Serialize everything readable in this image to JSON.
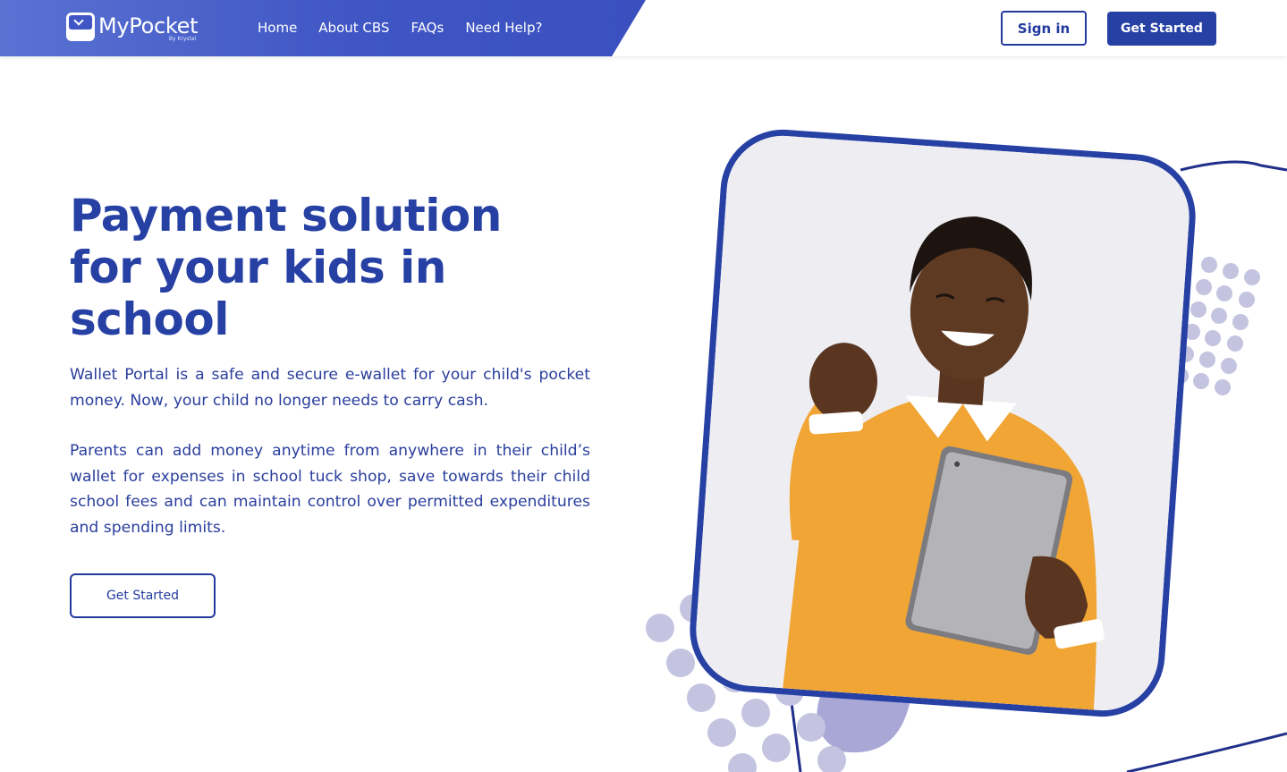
{
  "brand": {
    "name": "MyPocket",
    "byline": "By Krystal",
    "band_color": "#3f56c4"
  },
  "nav": {
    "items": [
      "Home",
      "About CBS",
      "FAQs",
      "Need Help?"
    ]
  },
  "header": {
    "signin_label": "Sign in",
    "get_started_label": "Get Started"
  },
  "hero": {
    "title": "Payment solution for your kids in school",
    "paragraph1": "Wallet Portal is a safe and secure e-wallet for your child's pocket money. Now, your child no longer needs to carry cash.",
    "paragraph2": "Parents can add money anytime from anywhere in their child’s wallet for expenses in school tuck shop, save towards their child school fees and can maintain control over permitted expenditures and spending limits.",
    "cta_label": "Get Started"
  },
  "colors": {
    "primary": "#2640a4",
    "accent_dots": "#b9bcdc",
    "sweater": "#f0a534"
  },
  "icons": [
    "wallet-logo-icon"
  ]
}
